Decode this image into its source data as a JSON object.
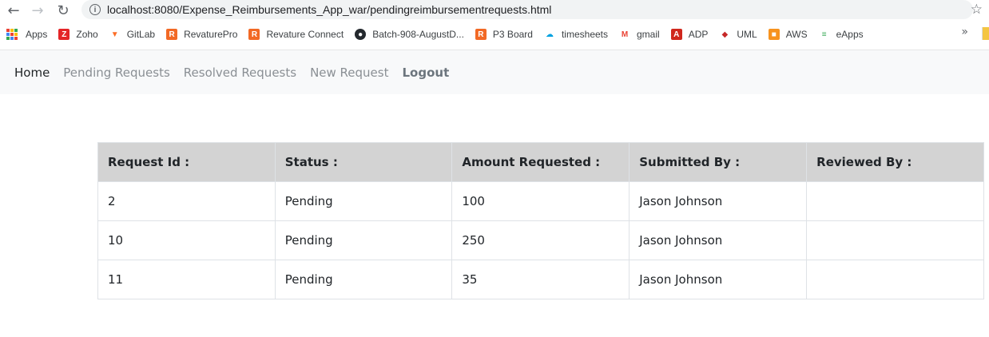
{
  "browser": {
    "url": "localhost:8080/Expense_Reimbursements_App_war/pendingreimbursementrequests.html",
    "bookmarks": [
      {
        "label": "Apps",
        "icon": "apps-grid-icon",
        "color": "#4285f4"
      },
      {
        "label": "Zoho",
        "icon": "zoho-icon",
        "color": "#e42527"
      },
      {
        "label": "GitLab",
        "icon": "gitlab-icon",
        "color": "#fc6d26"
      },
      {
        "label": "RevaturePro",
        "icon": "revature-icon",
        "color": "#f26925"
      },
      {
        "label": "Revature Connect",
        "icon": "revature-icon",
        "color": "#f26925"
      },
      {
        "label": "Batch-908-AugustD...",
        "icon": "github-icon",
        "color": "#24292e"
      },
      {
        "label": "P3 Board",
        "icon": "revature-icon",
        "color": "#f26925"
      },
      {
        "label": "timesheets",
        "icon": "salesforce-cloud-icon",
        "color": "#00a1e0"
      },
      {
        "label": "gmail",
        "icon": "gmail-icon",
        "color": "#ea4335"
      },
      {
        "label": "ADP",
        "icon": "adp-icon",
        "color": "#d0271d"
      },
      {
        "label": "UML",
        "icon": "uml-icon",
        "color": "#c62828"
      },
      {
        "label": "AWS",
        "icon": "aws-cube-icon",
        "color": "#f7931e"
      },
      {
        "label": "eApps",
        "icon": "eapps-icon",
        "color": "#34a853"
      }
    ],
    "more_label": "»"
  },
  "nav": {
    "home": "Home",
    "pending": "Pending Requests",
    "resolved": "Resolved Requests",
    "new_request": "New Request",
    "logout": "Logout"
  },
  "table": {
    "headers": [
      "Request Id :",
      "Status :",
      "Amount Requested :",
      "Submitted By :",
      "Reviewed By :"
    ],
    "rows": [
      [
        "2",
        "Pending",
        "100",
        "Jason Johnson",
        ""
      ],
      [
        "10",
        "Pending",
        "250",
        "Jason Johnson",
        ""
      ],
      [
        "11",
        "Pending",
        "35",
        "Jason Johnson",
        ""
      ]
    ]
  }
}
